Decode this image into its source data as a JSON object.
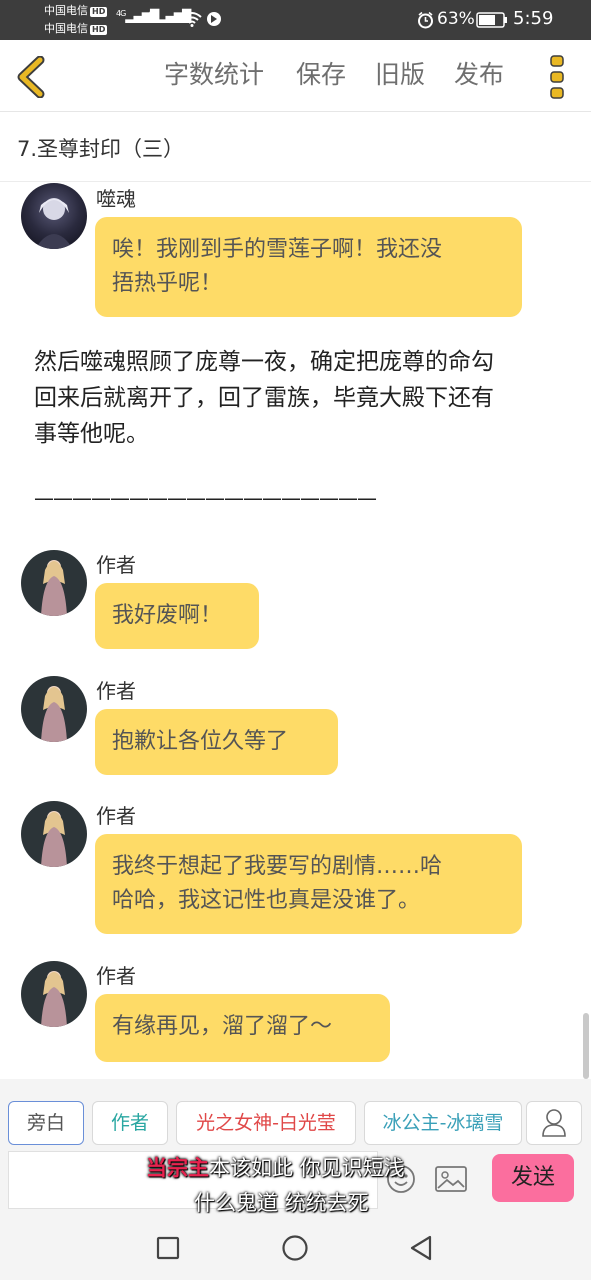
{
  "status_bar": {
    "carrier1": "中国电信",
    "carrier2": "中国电信",
    "hd": "HD",
    "net1": "4G",
    "net2": "4G",
    "battery_pct": "63%",
    "time": "5:59"
  },
  "toolbar": {
    "word_count": "字数统计",
    "save": "保存",
    "old_version": "旧版",
    "publish": "发布"
  },
  "chapter_title": "7.圣尊封印（三）",
  "messages": [
    {
      "speaker": "噬魂",
      "text_lines": [
        "唉！我刚到手的雪莲子啊！我还没",
        "捂热乎呢！"
      ]
    },
    {
      "speaker": "作者",
      "text_lines": [
        "我好废啊！"
      ]
    },
    {
      "speaker": "作者",
      "text_lines": [
        "抱歉让各位久等了"
      ]
    },
    {
      "speaker": "作者",
      "text_lines": [
        "我终于想起了我要写的剧情……哈",
        "哈哈，我这记性也真是没谁了。"
      ]
    },
    {
      "speaker": "作者",
      "text_lines": [
        "有缘再见，溜了溜了～"
      ]
    }
  ],
  "narration": {
    "lines": [
      "然后噬魂照顾了庞尊一夜，确定把庞尊的命勾",
      "回来后就离开了，回了雷族，毕竟大殿下还有",
      "事等他呢。"
    ],
    "divider": "——————————————————"
  },
  "roles": {
    "narrator": "旁白",
    "author": "作者",
    "role1": "光之女神-白光莹",
    "role2": "冰公主-冰璃雪"
  },
  "input": {
    "placeholder": "",
    "send": "发送"
  },
  "overlay": {
    "line1_highlight": "当宗主",
    "line1_rest": "本该如此 你见识短浅",
    "line2": "什么鬼道 统统去死"
  },
  "colors": {
    "bubble": "#fedb67",
    "send": "#fb6e9e",
    "author_role": "#2aa7a2",
    "goddess_role": "#e04848",
    "princess_role": "#3aa0b8",
    "back_arrow": "#e9b824",
    "menu_dots": "#e9b824"
  },
  "icons": [
    "back-arrow-icon",
    "menu-dots-icon",
    "emoji-icon",
    "image-icon",
    "user-icon",
    "nav-back-icon",
    "nav-home-icon",
    "nav-recent-icon"
  ]
}
